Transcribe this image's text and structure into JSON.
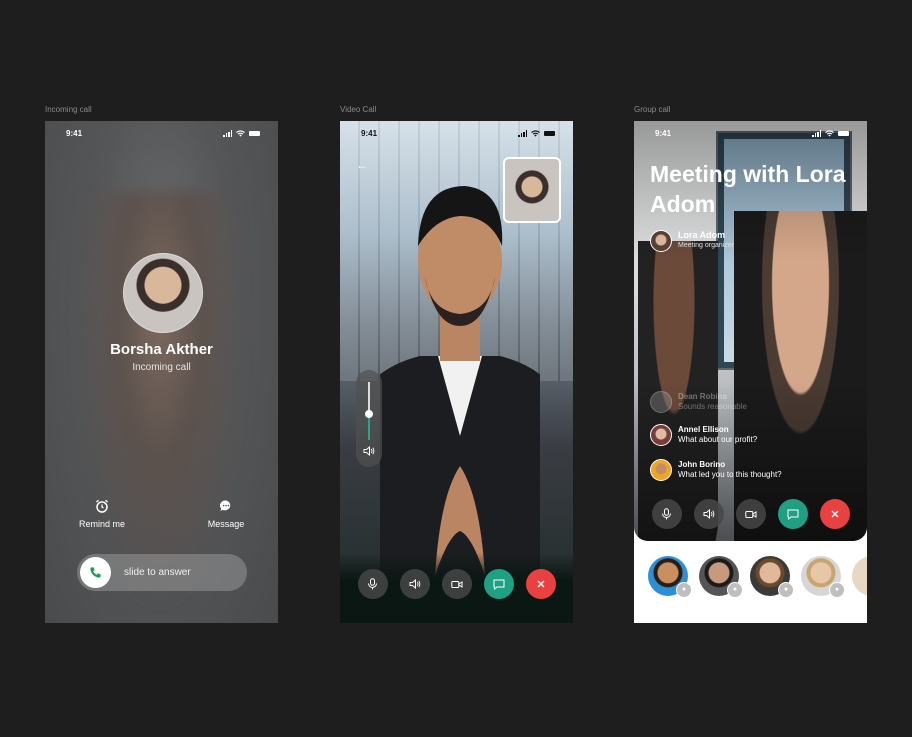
{
  "frames": {
    "incoming": {
      "label": "Incoming call",
      "time": "9:41",
      "caller_name": "Borsha Akther",
      "caller_status": "Incoming call",
      "remind_label": "Remind me",
      "message_label": "Message",
      "slide_label": "slide to answer"
    },
    "video": {
      "label": "Video Call",
      "time": "9:41",
      "volume_level": 0.45
    },
    "group": {
      "label": "Group call",
      "time": "9:41",
      "title": "Meeting with Lora Adom",
      "host": {
        "name": "Lora Adom",
        "role": "Meeting organizer"
      },
      "messages": [
        {
          "name": "Dean Robins",
          "text": "Sounds reasonable",
          "faded": true
        },
        {
          "name": "Annel Ellison",
          "text": "What about our profit?",
          "faded": false
        },
        {
          "name": "John Borino",
          "text": "What led you to this thought?",
          "faded": false
        }
      ]
    }
  },
  "colors": {
    "accent_green": "#1fa085",
    "end_red": "#e94040",
    "answer_green": "#1a9e57"
  },
  "icons": [
    "microphone-icon",
    "speaker-icon",
    "camera-icon",
    "chat-icon",
    "end-call-icon",
    "alarm-icon",
    "message-icon",
    "phone-icon",
    "back-arrow-icon"
  ]
}
